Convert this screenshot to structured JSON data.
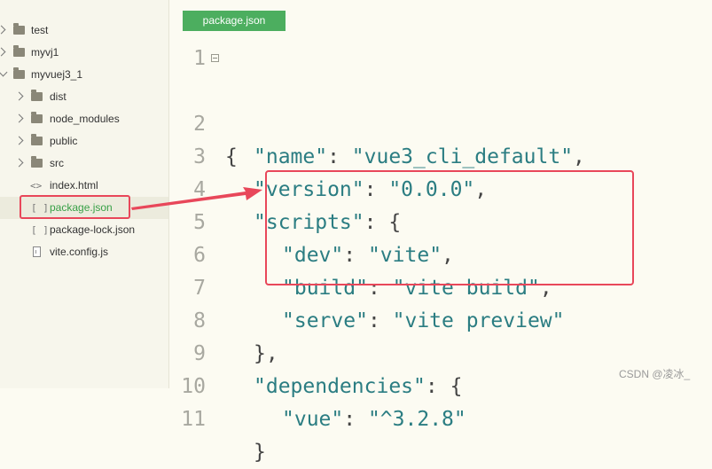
{
  "sidebar": {
    "items": [
      {
        "label": "test",
        "type": "folder",
        "expanded": false
      },
      {
        "label": "myvj1",
        "type": "folder",
        "expanded": false
      },
      {
        "label": "myvuej3_1",
        "type": "folder",
        "expanded": true
      },
      {
        "label": "dist",
        "type": "folder",
        "expanded": false
      },
      {
        "label": "node_modules",
        "type": "folder",
        "expanded": false
      },
      {
        "label": "public",
        "type": "folder",
        "expanded": false
      },
      {
        "label": "src",
        "type": "folder",
        "expanded": false
      },
      {
        "label": "index.html",
        "type": "html-file"
      },
      {
        "label": "package.json",
        "type": "json-file",
        "selected": true
      },
      {
        "label": "package-lock.json",
        "type": "json-file"
      },
      {
        "label": "vite.config.js",
        "type": "js-file"
      }
    ]
  },
  "editor": {
    "tab_label": "package.json",
    "lines": [
      {
        "num": "1"
      },
      {
        "num": "2",
        "key": "\"name\"",
        "value": "\"vue3_cli_default\"",
        "trail": ","
      },
      {
        "num": "3",
        "key": "\"version\"",
        "value": "\"0.0.0\"",
        "trail": ","
      },
      {
        "num": "4",
        "key": "\"scripts\"",
        "trail": ": {"
      },
      {
        "num": "5",
        "key": "\"dev\"",
        "value": "\"vite\"",
        "trail": ","
      },
      {
        "num": "6",
        "key": "\"build\"",
        "value": "\"vite build\"",
        "trail": ","
      },
      {
        "num": "7",
        "key": "\"serve\"",
        "value": "\"vite preview\""
      },
      {
        "num": "8",
        "text": "},"
      },
      {
        "num": "9",
        "key": "\"dependencies\"",
        "trail": ": {"
      },
      {
        "num": "10",
        "key": "\"vue\"",
        "value": "\"^3.2.8\""
      },
      {
        "num": "11",
        "text": "}"
      }
    ],
    "line1_text": "{"
  },
  "watermark": "CSDN @凌冰_",
  "colors": {
    "accent_tab": "#4cae5f",
    "annotation": "#e8475a",
    "selected_file": "#38a047"
  }
}
